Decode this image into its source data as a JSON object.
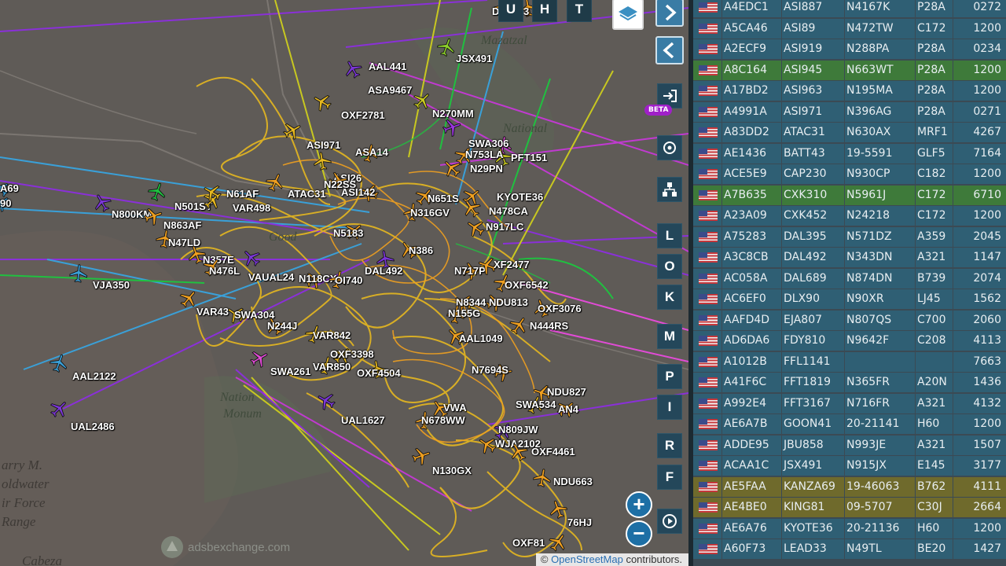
{
  "map": {
    "watermark": "adsbexchange.com",
    "attribution_prefix": "© ",
    "attribution_link": "OpenStreetMap",
    "attribution_suffix": " contributors.",
    "places": [
      {
        "text": "arry M."
      },
      {
        "text": "oldwater"
      },
      {
        "text": "ir Force"
      },
      {
        "text": "Range"
      },
      {
        "text": "Cabeza"
      },
      {
        "text": "Mazatzal"
      },
      {
        "text": "National"
      },
      {
        "text": "Nation"
      },
      {
        "text": "Monum"
      },
      {
        "text": "Good"
      }
    ],
    "aircraft": [
      {
        "label": "AAL441",
        "color": "#7b36d6"
      },
      {
        "label": "JSX491",
        "color": "#8ccf2a"
      },
      {
        "label": "ASA9467",
        "color": "#c8c820"
      },
      {
        "label": "OXF2781",
        "color": "#e6b820"
      },
      {
        "label": "N270MM",
        "color": "#9a34dc"
      },
      {
        "label": "SWA306",
        "color": "#e14bd6"
      },
      {
        "label": "PFT151",
        "color": "#c8c820"
      },
      {
        "label": "N753LA",
        "color": "#f0a020"
      },
      {
        "label": "N29PN",
        "color": "#f0a020"
      },
      {
        "label": "ASI971",
        "color": "#e6b820"
      },
      {
        "label": "ASA14",
        "color": "#f0a020"
      },
      {
        "label": "ASI26",
        "color": "#e6b820"
      },
      {
        "label": "N22SS",
        "color": "#f0a020"
      },
      {
        "label": "ASI142",
        "color": "#f0a020"
      },
      {
        "label": "ATAC31",
        "color": "#f0a020"
      },
      {
        "label": "KYOTE36",
        "color": "#f0a020"
      },
      {
        "label": "N478CA",
        "color": "#f0a020"
      },
      {
        "label": "N316GV",
        "color": "#f0a020"
      },
      {
        "label": "N651S",
        "color": "#f0a020"
      },
      {
        "label": "N917LC",
        "color": "#f0a020"
      },
      {
        "label": "N800KM",
        "color": "#7b36d6"
      },
      {
        "label": "N501ST",
        "color": "#20c040"
      },
      {
        "label": "VAR498",
        "color": "#e6b820"
      },
      {
        "label": "N61AF",
        "color": "#e6b820"
      },
      {
        "label": "N863AF",
        "color": "#f0a020"
      },
      {
        "label": "N47LD",
        "color": "#f0a020"
      },
      {
        "label": "N357E",
        "color": "#f0a020"
      },
      {
        "label": "N476L",
        "color": "#f0a020"
      },
      {
        "label": "VAUAL24",
        "color": "#7b36d6"
      },
      {
        "label": "N118CX",
        "color": "#f0a020"
      },
      {
        "label": "OI740",
        "color": "#f0a020"
      },
      {
        "label": "DAL492",
        "color": "#7b36d6"
      },
      {
        "label": "N717P",
        "color": "#f0a020"
      },
      {
        "label": "XF2477",
        "color": "#f0a020"
      },
      {
        "label": "OXF6542",
        "color": "#f0a020"
      },
      {
        "label": "N5183",
        "color": "#f0a020"
      },
      {
        "label": "N386",
        "color": "#f0a020"
      },
      {
        "label": "VJA350",
        "color": "#3aa0d8"
      },
      {
        "label": "VAR43",
        "color": "#f0a020"
      },
      {
        "label": "SWA304",
        "color": "#e6b820"
      },
      {
        "label": "N244J",
        "color": "#f0a020"
      },
      {
        "label": "VAR842",
        "color": "#e6b820"
      },
      {
        "label": "OXF3398",
        "color": "#e6b820"
      },
      {
        "label": "N8344",
        "color": "#f0a020"
      },
      {
        "label": "NDU813",
        "color": "#f0a020"
      },
      {
        "label": "N155G",
        "color": "#f0a020"
      },
      {
        "label": "OXF3076",
        "color": "#f0a020"
      },
      {
        "label": "N444RS",
        "color": "#f0a020"
      },
      {
        "label": "AAL1049",
        "color": "#f0a020"
      },
      {
        "label": "SWA261",
        "color": "#e14bd6"
      },
      {
        "label": "VAR850",
        "color": "#e6b820"
      },
      {
        "label": "OXF4504",
        "color": "#e6b820"
      },
      {
        "label": "N7694S",
        "color": "#f0a020"
      },
      {
        "label": "NDU827",
        "color": "#f0a020"
      },
      {
        "label": "SWA534",
        "color": "#e6b820"
      },
      {
        "label": "AN4",
        "color": "#f0a020"
      },
      {
        "label": "VWA",
        "color": "#f0a020"
      },
      {
        "label": "N678WW",
        "color": "#f0a020"
      },
      {
        "label": "N809JW",
        "color": "#7b36d6"
      },
      {
        "label": "WJA2102",
        "color": "#f0a020"
      },
      {
        "label": "OXF4461",
        "color": "#f0a020"
      },
      {
        "label": "AAL2122",
        "color": "#3aa0d8"
      },
      {
        "label": "UAL2486",
        "color": "#7b36d6"
      },
      {
        "label": "UAL1627",
        "color": "#7b36d6"
      },
      {
        "label": "N130GX",
        "color": "#f0a020"
      },
      {
        "label": "NDU663",
        "color": "#f0a020"
      },
      {
        "label": "76HJ",
        "color": "#f0a020"
      },
      {
        "label": "OXF81",
        "color": "#f0a020"
      },
      {
        "label": "A69",
        "color": "#3aa0d8"
      },
      {
        "label": "90",
        "color": "#3aa0d8"
      },
      {
        "label": "D",
        "color": "#f0a020"
      },
      {
        "label": "3",
        "color": "#f0a020"
      }
    ]
  },
  "controls": {
    "layer_buttons": [
      "U",
      "H",
      "T"
    ],
    "beta_label": "BETA",
    "keys": [
      "L",
      "O",
      "K",
      "M",
      "P",
      "I",
      "R",
      "F"
    ],
    "zoom_in": "+",
    "zoom_out": "−",
    "toggle_table": "◀▶"
  },
  "table": {
    "rows": [
      {
        "hex": "A4EDC1",
        "call": "ASI887",
        "reg": "N4167K",
        "type": "P28A",
        "alt": "0272",
        "hl": ""
      },
      {
        "hex": "A5CA46",
        "call": "ASI89",
        "reg": "N472TW",
        "type": "C172",
        "alt": "1200",
        "hl": ""
      },
      {
        "hex": "A2ECF9",
        "call": "ASI919",
        "reg": "N288PA",
        "type": "P28A",
        "alt": "0234",
        "hl": ""
      },
      {
        "hex": "A8C164",
        "call": "ASI945",
        "reg": "N663WT",
        "type": "P28A",
        "alt": "1200",
        "hl": "green"
      },
      {
        "hex": "A17BD2",
        "call": "ASI963",
        "reg": "N195MA",
        "type": "P28A",
        "alt": "1200",
        "hl": ""
      },
      {
        "hex": "A4991A",
        "call": "ASI971",
        "reg": "N396AG",
        "type": "P28A",
        "alt": "0271",
        "hl": ""
      },
      {
        "hex": "A83DD2",
        "call": "ATAC31",
        "reg": "N630AX",
        "type": "MRF1",
        "alt": "4267",
        "hl": ""
      },
      {
        "hex": "AE1436",
        "call": "BATT43",
        "reg": "19-5591",
        "type": "GLF5",
        "alt": "7164",
        "hl": ""
      },
      {
        "hex": "ACE5E9",
        "call": "CAP230",
        "reg": "N930CP",
        "type": "C182",
        "alt": "1200",
        "hl": ""
      },
      {
        "hex": "A7B635",
        "call": "CXK310",
        "reg": "N5961J",
        "type": "C172",
        "alt": "6710",
        "hl": "green"
      },
      {
        "hex": "A23A09",
        "call": "CXK452",
        "reg": "N24218",
        "type": "C172",
        "alt": "1200",
        "hl": ""
      },
      {
        "hex": "A75283",
        "call": "DAL395",
        "reg": "N571DZ",
        "type": "A359",
        "alt": "2045",
        "hl": ""
      },
      {
        "hex": "A3C8CB",
        "call": "DAL492",
        "reg": "N343DN",
        "type": "A321",
        "alt": "1147",
        "hl": ""
      },
      {
        "hex": "AC058A",
        "call": "DAL689",
        "reg": "N874DN",
        "type": "B739",
        "alt": "2074",
        "hl": ""
      },
      {
        "hex": "AC6EF0",
        "call": "DLX90",
        "reg": "N90XR",
        "type": "LJ45",
        "alt": "1562",
        "hl": ""
      },
      {
        "hex": "AAFD4D",
        "call": "EJA807",
        "reg": "N807QS",
        "type": "C700",
        "alt": "2060",
        "hl": ""
      },
      {
        "hex": "AD6DA6",
        "call": "FDY810",
        "reg": "N9642F",
        "type": "C208",
        "alt": "4113",
        "hl": ""
      },
      {
        "hex": "A1012B",
        "call": "FFL1141",
        "reg": "",
        "type": "",
        "alt": "7663",
        "hl": ""
      },
      {
        "hex": "A41F6C",
        "call": "FFT1819",
        "reg": "N365FR",
        "type": "A20N",
        "alt": "1436",
        "hl": ""
      },
      {
        "hex": "A992E4",
        "call": "FFT3167",
        "reg": "N716FR",
        "type": "A321",
        "alt": "4132",
        "hl": ""
      },
      {
        "hex": "AE6A7B",
        "call": "GOON41",
        "reg": "20-21141",
        "type": "H60",
        "alt": "1200",
        "hl": ""
      },
      {
        "hex": "ADDE95",
        "call": "JBU858",
        "reg": "N993JE",
        "type": "A321",
        "alt": "1507",
        "hl": ""
      },
      {
        "hex": "ACAA1C",
        "call": "JSX491",
        "reg": "N915JX",
        "type": "E145",
        "alt": "3177",
        "hl": ""
      },
      {
        "hex": "AE5FAA",
        "call": "KANZA69",
        "reg": "19-46063",
        "type": "B762",
        "alt": "4111",
        "hl": "yellow"
      },
      {
        "hex": "AE4BE0",
        "call": "KING81",
        "reg": "09-5707",
        "type": "C30J",
        "alt": "2664",
        "hl": "yellow"
      },
      {
        "hex": "AE6A76",
        "call": "KYOTE36",
        "reg": "20-21136",
        "type": "H60",
        "alt": "1200",
        "hl": ""
      },
      {
        "hex": "A60F73",
        "call": "LEAD33",
        "reg": "N49TL",
        "type": "BE20",
        "alt": "1427",
        "hl": ""
      }
    ]
  }
}
